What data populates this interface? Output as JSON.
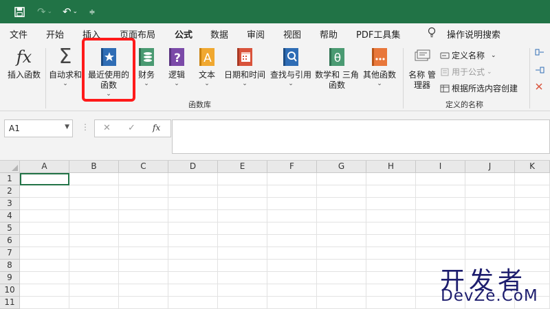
{
  "quick_access": {
    "save_icon": "save-icon",
    "redo_icon": "redo-icon",
    "undo_icon": "undo-icon",
    "customize_icon": "customize-qat-icon"
  },
  "menu": {
    "tabs": [
      {
        "label": "文件"
      },
      {
        "label": "开始"
      },
      {
        "label": "插入"
      },
      {
        "label": "页面布局"
      },
      {
        "label": "公式",
        "active": true
      },
      {
        "label": "数据"
      },
      {
        "label": "审阅"
      },
      {
        "label": "视图"
      },
      {
        "label": "帮助"
      },
      {
        "label": "PDF工具集"
      }
    ],
    "tell_me": "操作说明搜索"
  },
  "ribbon": {
    "insert_function": "插入函数",
    "autosum": "自动求和",
    "recent_line1": "最近使用的",
    "recent_line2": "函数",
    "financial": "财务",
    "logical": "逻辑",
    "text": "文本",
    "datetime": "日期和时间",
    "lookup": "查找与引用",
    "math_line1": "数学和",
    "math_line2": "三角函数",
    "more": "其他函数",
    "group_library": "函数库",
    "name_manager_line1": "名称",
    "name_manager_line2": "管理器",
    "define_name": "定义名称",
    "use_in_formula": "用于公式",
    "create_from_selection": "根据所选内容创建",
    "group_defined_names": "定义的名称",
    "caret": "⌄"
  },
  "formula_bar": {
    "name_box": "A1",
    "cancel": "✕",
    "enter": "✓",
    "fx": "fx",
    "content": ""
  },
  "grid": {
    "columns": [
      "A",
      "B",
      "C",
      "D",
      "E",
      "F",
      "G",
      "H",
      "I",
      "J",
      "K"
    ],
    "rows": [
      "1",
      "2",
      "3",
      "4",
      "5",
      "6",
      "7",
      "8",
      "9",
      "10",
      "11"
    ]
  },
  "watermark": {
    "line1": "开发者",
    "line2": "DevZe.CoM"
  },
  "colors": {
    "accent": "#217346",
    "highlight": "#ff1a1a"
  }
}
